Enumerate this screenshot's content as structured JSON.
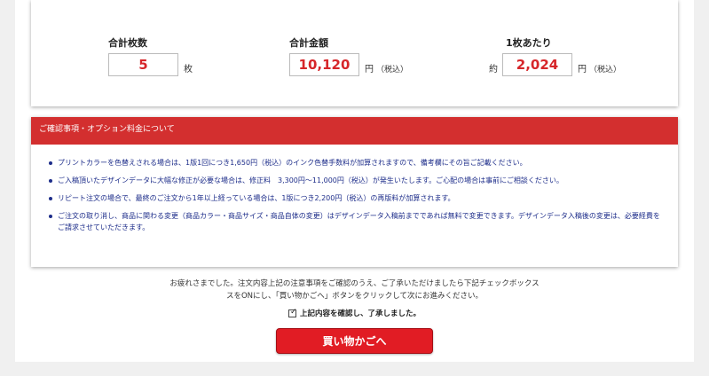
{
  "summary": {
    "quantity": {
      "label": "合計枚数",
      "value": "5",
      "unit": "枚"
    },
    "total": {
      "label": "合計金額",
      "value": "10,120",
      "unit": "円",
      "tax": "（税込）"
    },
    "per_item": {
      "label": "1枚あたり",
      "prefix": "約",
      "value": "2,024",
      "unit": "円",
      "tax": "（税込）"
    }
  },
  "notice": {
    "title": "ご確認事項・オプション料金について",
    "items": [
      "プリントカラーを色替えされる場合は、1版1回につき1,650円（税込）のインク色替手数料が加算されますので、備考欄にその旨ご記載ください。",
      "ご入稿頂いたデザインデータに大幅な修正が必要な場合は、修正料　3,300円〜11,000円（税込）が発生いたします。ご心配の場合は事前にご相談ください。",
      "リピート注文の場合で、最終のご注文から1年以上経っている場合は、1版につき2,200円（税込）の再版料が加算されます。",
      "ご注文の取り消し、商品に関わる変更（商品カラー・商品サイズ・商品自体の変更）はデザインデータ入稿前までであれば無料で変更できます。デザインデータ入稿後の変更は、必要経費をご請求させていただきます。"
    ]
  },
  "confirm": {
    "line1": "お疲れさまでした。注文内容上記の注意事項をご確認のうえ、ご了承いただけましたら下記チェックボックス",
    "line2": "スをONにし、「買い物かごへ」ボタンをクリックして次にお進みください。",
    "checkbox_label": "上記内容を確認し、了承しました。",
    "checked": true
  },
  "cart_button": {
    "label": "買い物かごへ"
  },
  "colors": {
    "accent": "#e11c24",
    "header": "#d32f2f",
    "notice_text": "#1d2d8a",
    "price": "#d6262a"
  }
}
